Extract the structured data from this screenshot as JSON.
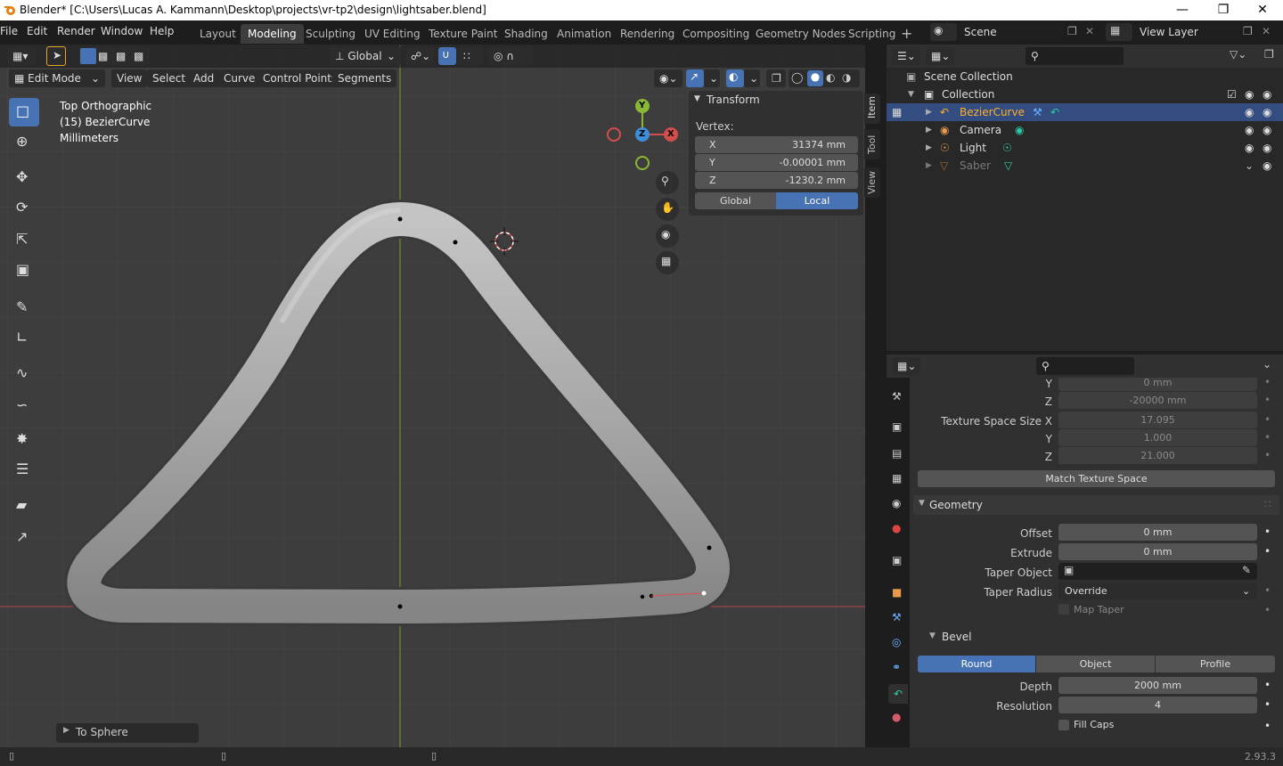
{
  "titlebar": {
    "title": "Blender* [C:\\Users\\Lucas A. Kammann\\Desktop\\projects\\vr-tp2\\design\\lightsaber.blend]",
    "min_icon": "minimize-icon",
    "max_icon": "maximize-icon",
    "close_icon": "close-icon"
  },
  "menu": {
    "file": "File",
    "edit": "Edit",
    "render": "Render",
    "window": "Window",
    "help": "Help"
  },
  "workspaces": [
    "Layout",
    "Modeling",
    "Sculpting",
    "UV Editing",
    "Texture Paint",
    "Shading",
    "Animation",
    "Rendering",
    "Compositing",
    "Geometry Nodes",
    "Scripting"
  ],
  "scene": {
    "name": "Scene",
    "view_layer": "View Layer"
  },
  "viewport": {
    "mode": "Edit Mode",
    "menus": [
      "View",
      "Select",
      "Add",
      "Curve",
      "Control Points",
      "Segments"
    ],
    "orientation": "Global",
    "overlay_info": [
      "Top Orthographic",
      "(15) BezierCurve",
      "Millimeters"
    ],
    "last_op": "To Sphere",
    "gizmo": {
      "x": "X",
      "y": "Y",
      "z": "Z"
    }
  },
  "npanel": {
    "section": "Transform",
    "vertex_label": "Vertex:",
    "rows": [
      {
        "axis": "X",
        "value": "31374 mm"
      },
      {
        "axis": "Y",
        "value": "-0.00001 mm"
      },
      {
        "axis": "Z",
        "value": "-1230.2 mm"
      }
    ],
    "global": "Global",
    "local": "Local",
    "tabs": [
      "Item",
      "Tool",
      "View"
    ]
  },
  "outliner": {
    "scene_collection": "Scene Collection",
    "collection": "Collection",
    "items": [
      {
        "name": "BezierCurve",
        "selected": true
      },
      {
        "name": "Camera"
      },
      {
        "name": "Light"
      },
      {
        "name": "Saber",
        "dim": true
      }
    ]
  },
  "props": {
    "y_label": "Y",
    "y_value": "0 mm",
    "z_label": "Z",
    "z_value": "-20000 mm",
    "tss_label": "Texture Space Size X",
    "tss_x": "17.095",
    "tss_y_label": "Y",
    "tss_y": "1.000",
    "tss_z_label": "Z",
    "tss_z": "21.000",
    "match": "Match Texture Space",
    "geometry": "Geometry",
    "offset_label": "Offset",
    "offset": "0 mm",
    "extrude_label": "Extrude",
    "extrude": "0 mm",
    "taper_obj_label": "Taper Object",
    "taper_radius_label": "Taper Radius",
    "taper_radius": "Override",
    "map_taper": "Map Taper",
    "bevel": "Bevel",
    "bevel_tabs": [
      "Round",
      "Object",
      "Profile"
    ],
    "depth_label": "Depth",
    "depth": "2000 mm",
    "res_label": "Resolution",
    "res": "4",
    "fill_caps": "Fill Caps"
  },
  "status": {
    "version": "2.93.3"
  },
  "colors": {
    "accent": "#4772b3",
    "selected_text": "#ffaf29",
    "x_axis": "#d44d4d",
    "y_axis": "#8ab833",
    "z_axis": "#3d8dd9"
  }
}
